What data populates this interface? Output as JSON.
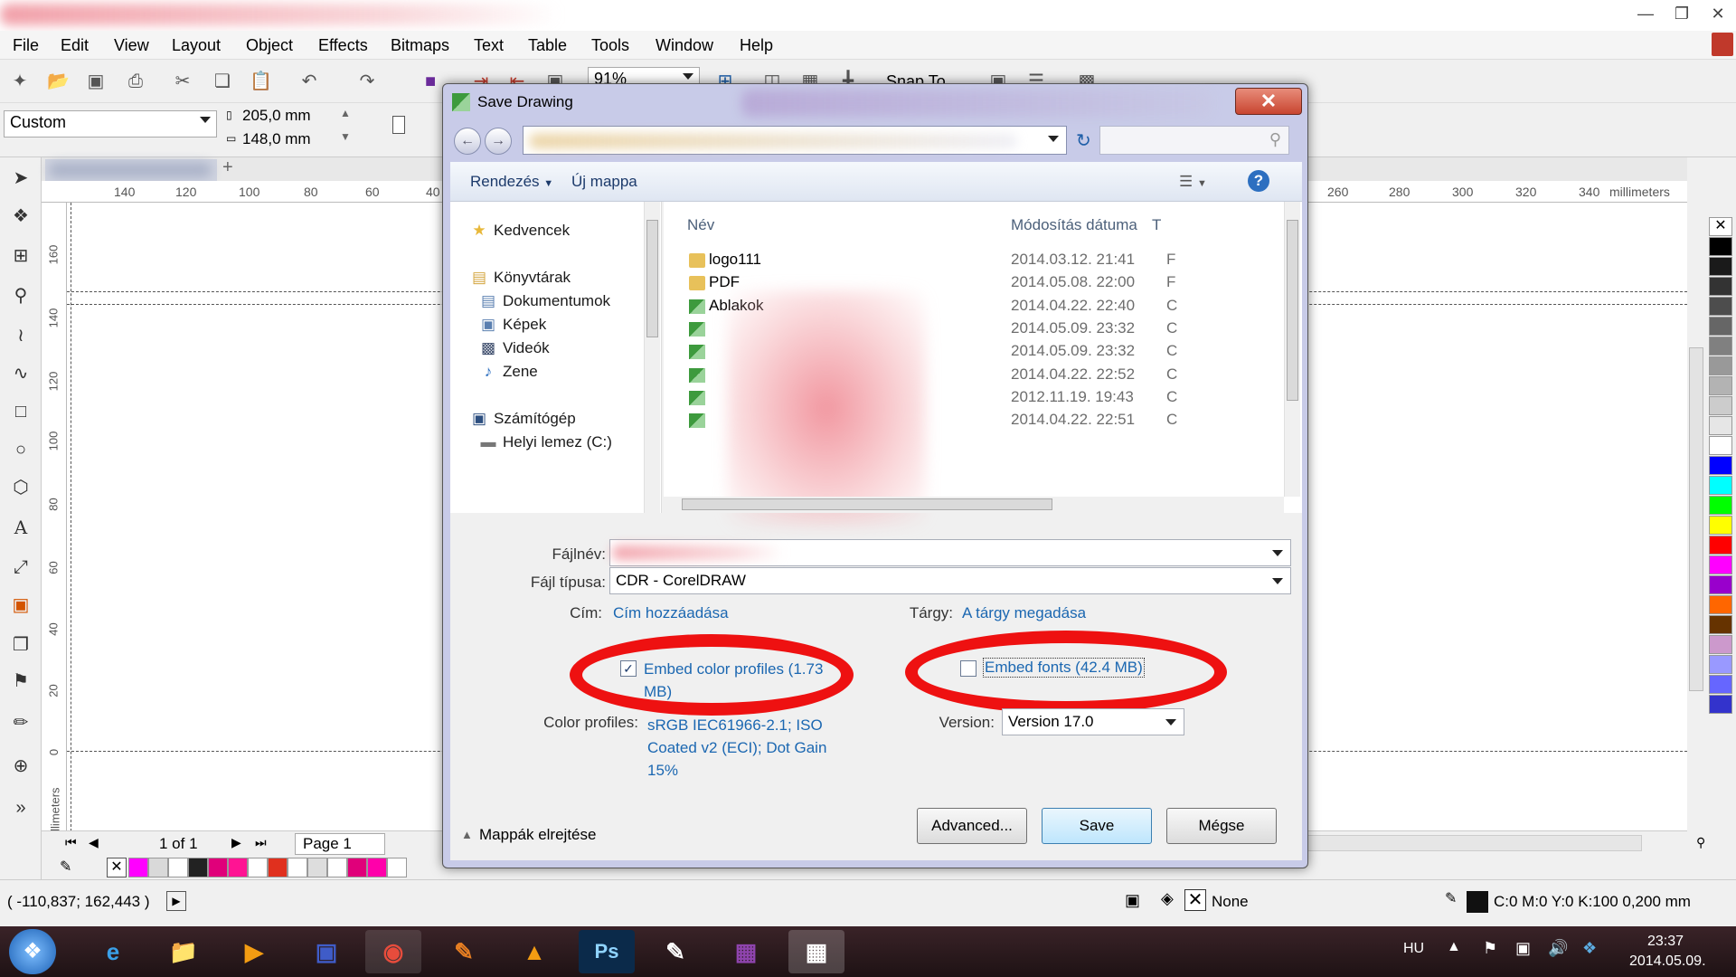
{
  "menu": [
    "File",
    "Edit",
    "View",
    "Layout",
    "Object",
    "Effects",
    "Bitmaps",
    "Text",
    "Table",
    "Tools",
    "Window",
    "Help"
  ],
  "toolbar": {
    "zoom": "91%",
    "snap_to": "Snap To"
  },
  "property_bar": {
    "paper_preset": "Custom",
    "width": "205,0 mm",
    "height": "148,0 mm"
  },
  "ruler": {
    "h_labels": [
      "140",
      "120",
      "100",
      "80",
      "60",
      "40",
      "260",
      "280",
      "300",
      "320",
      "340"
    ],
    "units": "millimeters",
    "v_labels": [
      "160",
      "140",
      "120",
      "100",
      "80",
      "60",
      "40",
      "20",
      "0"
    ],
    "v_units": "millimeters"
  },
  "pagebar": {
    "page_count": "1 of 1",
    "page_tab": "Page 1"
  },
  "status": {
    "coords": "( -110,837; 162,443 )",
    "fill": "None",
    "outline": "C:0 M:0 Y:0 K:100  0,200 mm"
  },
  "taskbar": {
    "lang": "HU",
    "time": "23:37",
    "date": "2014.05.09."
  },
  "dialog": {
    "title": "Save Drawing",
    "cmd": {
      "organize": "Rendezés",
      "new_folder": "Új mappa"
    },
    "nav": {
      "favorites": "Kedvencek",
      "libraries": "Könyvtárak",
      "documents": "Dokumentumok",
      "pictures": "Képek",
      "videos": "Videók",
      "music": "Zene",
      "computer": "Számítógép",
      "local_disk": "Helyi lemez (C:)"
    },
    "columns": {
      "name": "Név",
      "modified": "Módosítás dátuma",
      "type": "T"
    },
    "files": [
      {
        "name": "logo111",
        "date": "2014.03.12. 21:41",
        "type": "F",
        "kind": "folder"
      },
      {
        "name": "PDF",
        "date": "2014.05.08. 22:00",
        "type": "F",
        "kind": "folder"
      },
      {
        "name": "Ablakok",
        "date": "2014.04.22. 22:40",
        "type": "C",
        "kind": "cdr"
      },
      {
        "name": "",
        "date": "2014.05.09. 23:32",
        "type": "C",
        "kind": "cdr"
      },
      {
        "name": "",
        "date": "2014.05.09. 23:32",
        "type": "C",
        "kind": "cdr"
      },
      {
        "name": "",
        "date": "2014.04.22. 22:52",
        "type": "C",
        "kind": "cdr"
      },
      {
        "name": "",
        "date": "2012.11.19. 19:43",
        "type": "C",
        "kind": "cdr"
      },
      {
        "name": "",
        "date": "2014.04.22. 22:51",
        "type": "C",
        "kind": "cdr"
      }
    ],
    "filename_label": "Fájlnév:",
    "filetype_label": "Fájl típusa:",
    "filetype_value": "CDR - CorelDRAW",
    "title_label": "Cím:",
    "title_link": "Cím hozzáadása",
    "subject_label": "Tárgy:",
    "subject_link": "A tárgy megadása",
    "embed_profiles": "Embed color profiles (1.73 MB)",
    "embed_fonts": "Embed fonts (42.4 MB)",
    "color_profiles_label": "Color profiles:",
    "color_profiles_value": "sRGB IEC61966-2.1; ISO Coated v2 (ECI); Dot Gain 15%",
    "version_label": "Version:",
    "version_value": "Version 17.0",
    "hide_folders": "Mappák elrejtése",
    "buttons": {
      "advanced": "Advanced...",
      "save": "Save",
      "cancel": "Mégse"
    }
  },
  "palette": [
    "#000000",
    "#1a1a1a",
    "#333333",
    "#4d4d4d",
    "#666666",
    "#808080",
    "#999999",
    "#b3b3b3",
    "#cccccc",
    "#e6e6e6",
    "#ffffff",
    "#0000ff",
    "#00ffff",
    "#00ff00",
    "#ffff00",
    "#ff0000",
    "#ff00ff",
    "#9900cc",
    "#ff6600",
    "#663300",
    "#cc99cc",
    "#9999ff",
    "#6666ff",
    "#3333cc"
  ],
  "colorbar": [
    "#ff00ff",
    "#d9d9d9",
    "#ffffff",
    "#222222",
    "#e0007a",
    "#ff1493",
    "#ffffff",
    "#e0301e",
    "#ffffff",
    "#dddddd",
    "#ffffff",
    "#e0007a",
    "#ff00aa",
    "#ffffff"
  ]
}
